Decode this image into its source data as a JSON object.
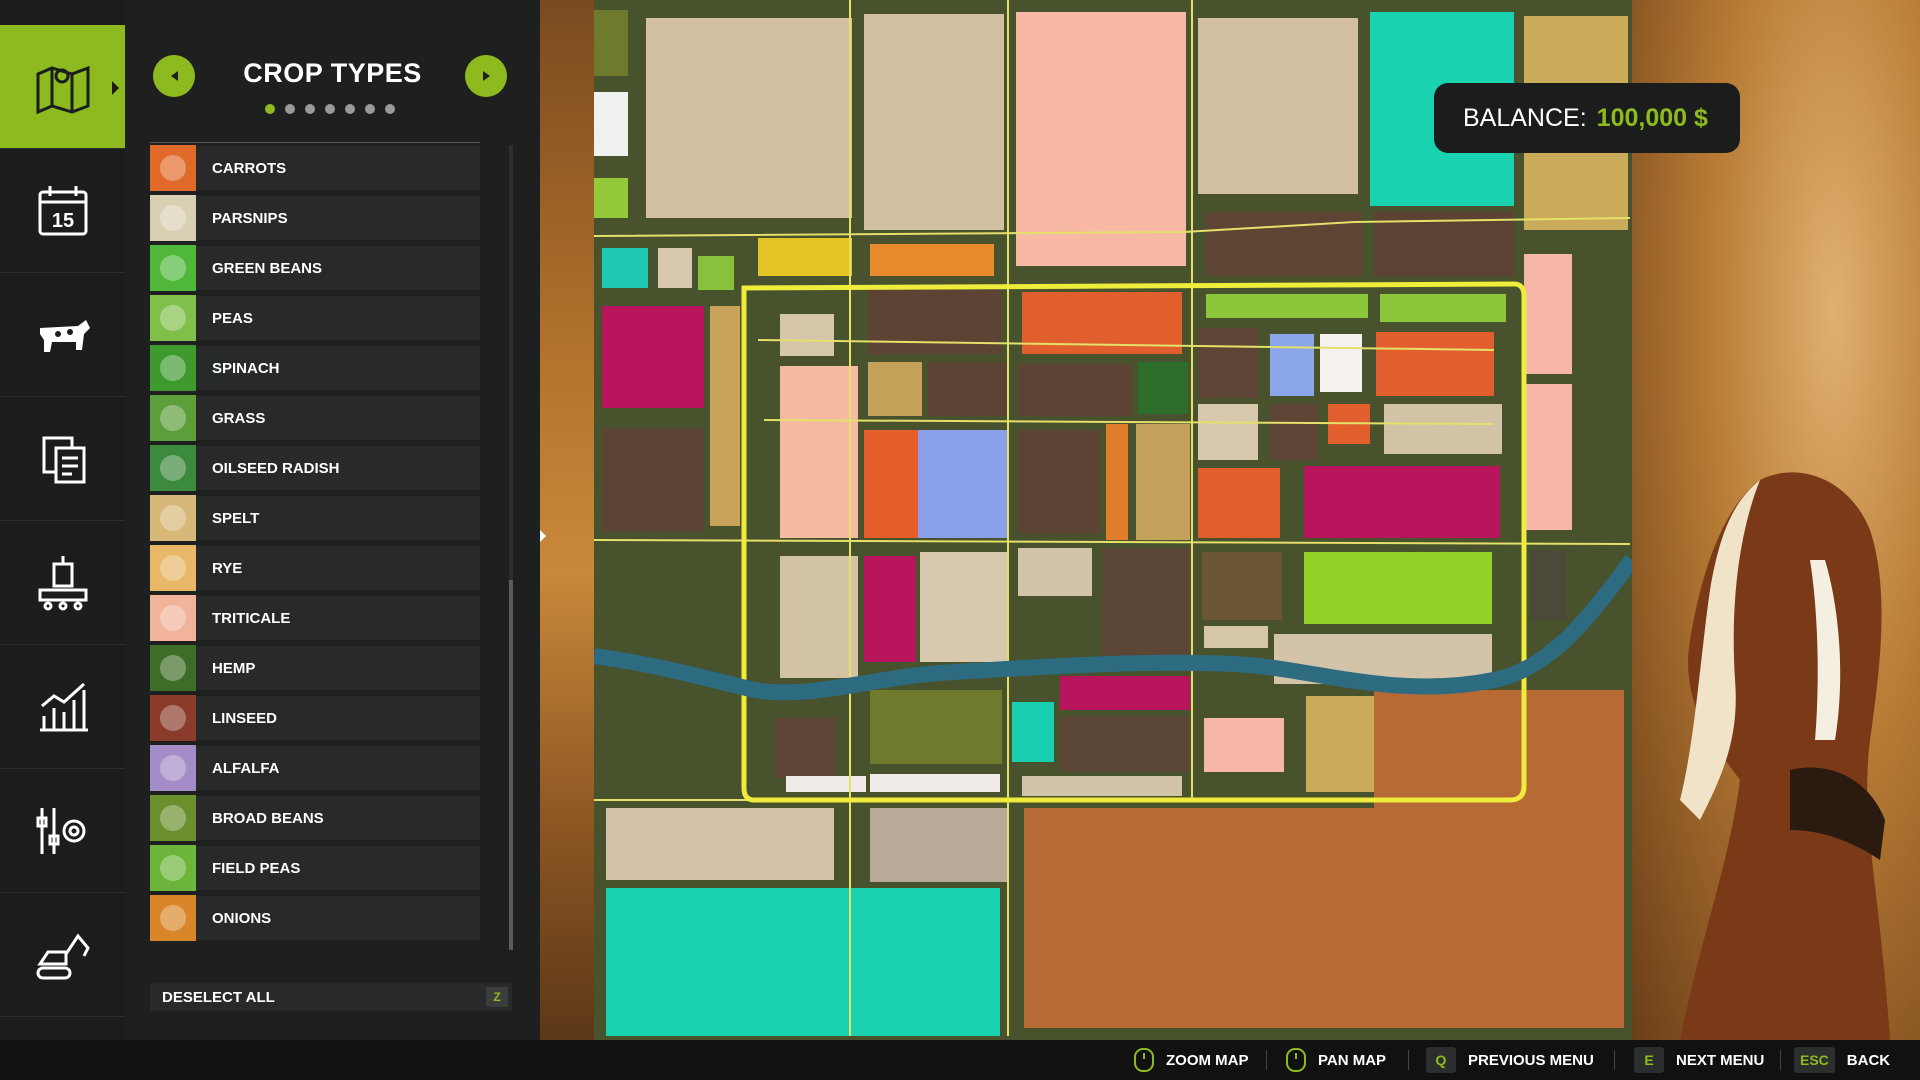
{
  "panel": {
    "title": "CROP TYPES",
    "page_count": 7,
    "active_page": 0,
    "deselect_label": "DESELECT ALL",
    "deselect_key": "Z"
  },
  "rail": {
    "items": [
      {
        "name": "map-icon",
        "active": true
      },
      {
        "name": "calendar-icon",
        "active": false,
        "text": "15"
      },
      {
        "name": "animals-icon",
        "active": false
      },
      {
        "name": "contracts-icon",
        "active": false
      },
      {
        "name": "production-icon",
        "active": false
      },
      {
        "name": "statistics-icon",
        "active": false
      },
      {
        "name": "settings-icon",
        "active": false
      },
      {
        "name": "construction-icon",
        "active": false
      }
    ]
  },
  "crops": [
    {
      "label": "CARROTS",
      "color": "#e06a2a"
    },
    {
      "label": "PARSNIPS",
      "color": "#d9cfb3"
    },
    {
      "label": "GREEN BEANS",
      "color": "#4fb83a"
    },
    {
      "label": "PEAS",
      "color": "#7fbf4a"
    },
    {
      "label": "SPINACH",
      "color": "#3f9a2e"
    },
    {
      "label": "GRASS",
      "color": "#5c9e3a"
    },
    {
      "label": "OILSEED RADISH",
      "color": "#3c8a3e"
    },
    {
      "label": "SPELT",
      "color": "#d7b878"
    },
    {
      "label": "RYE",
      "color": "#e8b767"
    },
    {
      "label": "TRITICALE",
      "color": "#f1b49a"
    },
    {
      "label": "HEMP",
      "color": "#3e6d27"
    },
    {
      "label": "LINSEED",
      "color": "#8a3b2a"
    },
    {
      "label": "ALFALFA",
      "color": "#a48cc6"
    },
    {
      "label": "BROAD BEANS",
      "color": "#6a8f2c"
    },
    {
      "label": "FIELD PEAS",
      "color": "#6cb43a"
    },
    {
      "label": "ONIONS",
      "color": "#d9862a"
    }
  ],
  "balance": {
    "label": "BALANCE:",
    "value": "100,000 $"
  },
  "bottom_hints": {
    "zoom_label": "ZOOM MAP",
    "pan_label": "PAN MAP",
    "prev_key": "Q",
    "prev_label": "PREVIOUS MENU",
    "next_key": "E",
    "next_label": "NEXT MENU",
    "back_key": "ESC",
    "back_label": "BACK"
  },
  "colors": {
    "accent": "#8dbb1f",
    "panel_bg": "#1e201f",
    "rail_bg": "#1b1d1c"
  }
}
